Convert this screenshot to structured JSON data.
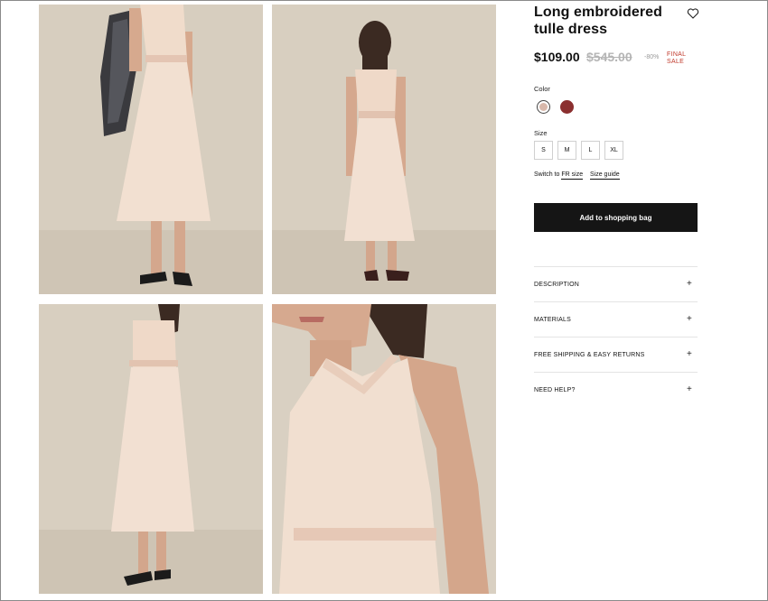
{
  "product": {
    "title": "Long embroidered tulle dress",
    "price": "$109.00",
    "old_price": "$545.00",
    "discount": "-80%",
    "sale_badge": "FINAL SALE",
    "wishlist_icon": "heart-icon"
  },
  "color": {
    "label": "Color",
    "options": [
      {
        "name": "nude",
        "hex": "#d8b8ab",
        "selected": true
      },
      {
        "name": "burgundy",
        "hex": "#8b2f2f",
        "selected": false
      }
    ]
  },
  "size": {
    "label": "Size",
    "options": [
      "S",
      "M",
      "L",
      "XL"
    ],
    "switch_prefix": "Switch to ",
    "switch_link": "FR size",
    "guide": "Size guide"
  },
  "cart": {
    "add_label": "Add to shopping bag"
  },
  "accordion": [
    {
      "label": "DESCRIPTION",
      "icon": "plus-icon"
    },
    {
      "label": "MATERIALS",
      "icon": "plus-icon"
    },
    {
      "label": "FREE SHIPPING & EASY RETURNS",
      "icon": "plus-icon"
    },
    {
      "label": "NEED HELP?",
      "icon": "plus-icon"
    }
  ],
  "gallery": [
    {
      "view": "front-with-jacket"
    },
    {
      "view": "back"
    },
    {
      "view": "side"
    },
    {
      "view": "close-up"
    }
  ],
  "colors": {
    "background": "#d6cdbf",
    "dress": "#f1dccd",
    "button": "#151515",
    "sale": "#c0392b"
  }
}
